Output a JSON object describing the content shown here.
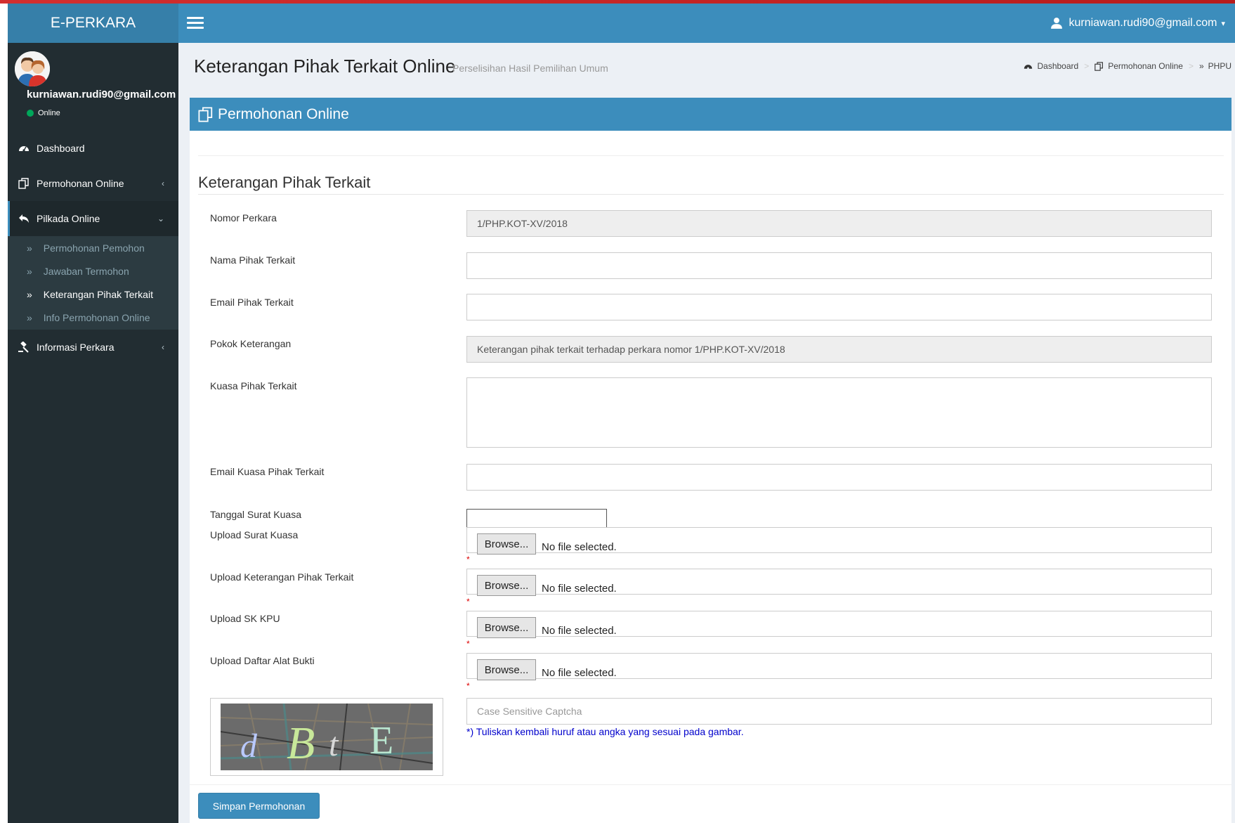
{
  "app": {
    "brand": "E-PERKARA"
  },
  "header": {
    "user_email": "kurniawan.rudi90@gmail.com"
  },
  "sidebar": {
    "user_email": "kurniawan.rudi90@gmail.com",
    "status": "Online",
    "items": [
      {
        "label": "Dashboard",
        "icon": "dashboard-icon"
      },
      {
        "label": "Permohonan Online",
        "icon": "copy-icon"
      },
      {
        "label": "Pilkada Online",
        "icon": "reply-icon"
      },
      {
        "label": "Informasi Perkara",
        "icon": "gavel-icon"
      }
    ],
    "submenu": [
      {
        "label": "Permohonan Pemohon"
      },
      {
        "label": "Jawaban Termohon"
      },
      {
        "label": "Keterangan Pihak Terkait"
      },
      {
        "label": "Info Permohonan Online"
      }
    ]
  },
  "page": {
    "title": "Keterangan Pihak Terkait Online",
    "subtitle": "Perselisihan Hasil Pemilihan Umum",
    "breadcrumb": [
      "Dashboard",
      "Permohonan Online",
      "PHPU"
    ]
  },
  "box": {
    "title": "Permohonan Online"
  },
  "form": {
    "section_title": "Keterangan Pihak Terkait",
    "nomor_perkara": {
      "label": "Nomor Perkara",
      "value": "1/PHP.KOT-XV/2018"
    },
    "nama": {
      "label": "Nama Pihak Terkait",
      "value": ""
    },
    "email": {
      "label": "Email Pihak Terkait",
      "value": ""
    },
    "pokok": {
      "label": "Pokok Keterangan",
      "value": "Keterangan pihak terkait terhadap perkara nomor 1/PHP.KOT-XV/2018"
    },
    "kuasa": {
      "label": "Kuasa Pihak Terkait",
      "value": ""
    },
    "email_kuasa": {
      "label": "Email Kuasa Pihak Terkait",
      "value": ""
    },
    "tanggal": {
      "label": "Tanggal Surat Kuasa",
      "value": ""
    },
    "uploads": [
      {
        "label": "Upload Surat Kuasa",
        "button": "Browse...",
        "status": "No file selected."
      },
      {
        "label": "Upload Keterangan Pihak Terkait",
        "button": "Browse...",
        "status": "No file selected."
      },
      {
        "label": "Upload SK KPU",
        "button": "Browse...",
        "status": "No file selected."
      },
      {
        "label": "Upload Daftar Alat Bukti",
        "button": "Browse...",
        "status": "No file selected."
      }
    ],
    "required_mark": "*",
    "captcha": {
      "text": "dBtE",
      "placeholder": "Case Sensitive Captcha",
      "hint": "*) Tuliskan kembali huruf atau angka yang sesuai pada gambar."
    },
    "submit_label": "Simpan Permohonan"
  },
  "colors": {
    "primary": "#3c8dbc",
    "brand_bg": "#367fa9",
    "sidebar_bg": "#222d32",
    "required": "#dd0000",
    "hint": "#0000cc"
  }
}
